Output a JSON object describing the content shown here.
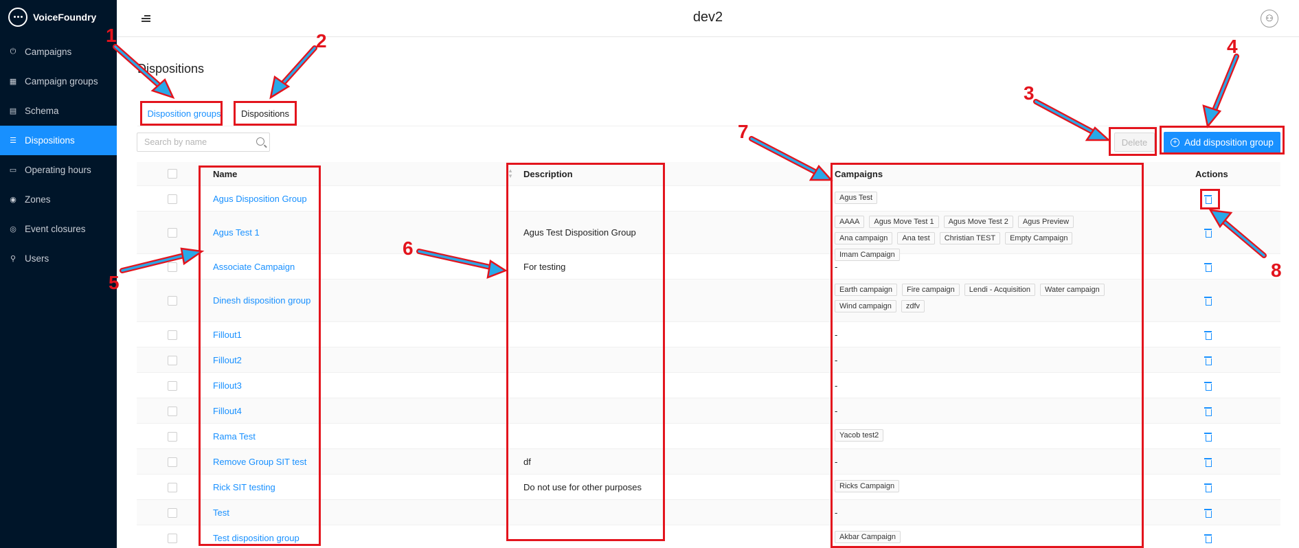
{
  "app": {
    "name": "VoiceFoundry",
    "env": "dev2"
  },
  "sidebar": {
    "items": [
      {
        "label": "Campaigns",
        "icon": "power-icon"
      },
      {
        "label": "Campaign groups",
        "icon": "campaign-groups-icon"
      },
      {
        "label": "Schema",
        "icon": "schema-icon"
      },
      {
        "label": "Dispositions",
        "icon": "list-icon",
        "active": true
      },
      {
        "label": "Operating hours",
        "icon": "calendar-icon"
      },
      {
        "label": "Zones",
        "icon": "location-pin-icon"
      },
      {
        "label": "Event closures",
        "icon": "closure-icon"
      },
      {
        "label": "Users",
        "icon": "user-icon"
      }
    ]
  },
  "page": {
    "title": "Dispositions"
  },
  "tabs": [
    {
      "label": "Disposition groups"
    },
    {
      "label": "Dispositions"
    }
  ],
  "search": {
    "placeholder": "Search by name"
  },
  "toolbar": {
    "delete_label": "Delete",
    "add_label": "Add disposition group"
  },
  "table": {
    "headers": {
      "name": "Name",
      "description": "Description",
      "campaigns": "Campaigns",
      "actions": "Actions"
    },
    "rows": [
      {
        "name": "Agus Disposition Group",
        "description": "",
        "campaigns": [
          "Agus Test"
        ]
      },
      {
        "name": "Agus Test 1",
        "description": "Agus Test Disposition Group",
        "campaigns": [
          "AAAA",
          "Agus Move Test 1",
          "Agus Move Test 2",
          "Agus Preview",
          "Ana campaign",
          "Ana test",
          "Christian TEST",
          "Empty Campaign",
          "Imam Campaign"
        ]
      },
      {
        "name": "Associate Campaign",
        "description": "For testing",
        "campaigns": []
      },
      {
        "name": "Dinesh disposition group",
        "description": "",
        "campaigns": [
          "Earth campaign",
          "Fire campaign",
          "Lendi - Acquisition",
          "Water campaign",
          "Wind campaign",
          "zdfv"
        ]
      },
      {
        "name": "Fillout1",
        "description": "",
        "campaigns": []
      },
      {
        "name": "Fillout2",
        "description": "",
        "campaigns": []
      },
      {
        "name": "Fillout3",
        "description": "",
        "campaigns": []
      },
      {
        "name": "Fillout4",
        "description": "",
        "campaigns": []
      },
      {
        "name": "Rama Test",
        "description": "",
        "campaigns": [
          "Yacob test2"
        ]
      },
      {
        "name": "Remove Group SIT test",
        "description": "df",
        "campaigns": []
      },
      {
        "name": "Rick SIT testing",
        "description": "Do not use for other purposes",
        "campaigns": [
          "Ricks Campaign"
        ]
      },
      {
        "name": "Test",
        "description": "",
        "campaigns": []
      },
      {
        "name": "Test disposition group",
        "description": "",
        "campaigns": [
          "Akbar Campaign"
        ]
      }
    ],
    "empty_campaigns_text": "-"
  },
  "annotations": [
    "1",
    "2",
    "3",
    "4",
    "5",
    "6",
    "7",
    "8"
  ],
  "colors": {
    "sidebar_bg": "#001529",
    "accent": "#1890ff",
    "annotation_red": "#e3141d"
  }
}
